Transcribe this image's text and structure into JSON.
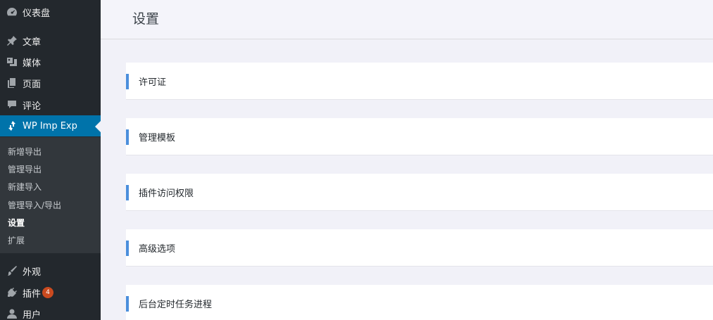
{
  "sidebar": {
    "items": [
      {
        "label": "仪表盘",
        "icon": "dashboard-icon"
      },
      {
        "label": "文章",
        "icon": "pin-icon"
      },
      {
        "label": "媒体",
        "icon": "media-icon"
      },
      {
        "label": "页面",
        "icon": "pages-icon"
      },
      {
        "label": "评论",
        "icon": "comment-icon"
      },
      {
        "label": "WP Imp Exp",
        "icon": "import-export-icon"
      },
      {
        "label": "外观",
        "icon": "brush-icon"
      },
      {
        "label": "插件",
        "icon": "plugin-icon",
        "badge": "4"
      },
      {
        "label": "用户",
        "icon": "user-icon"
      }
    ],
    "submenu": [
      {
        "label": "新增导出"
      },
      {
        "label": "管理导出"
      },
      {
        "label": "新建导入"
      },
      {
        "label": "管理导入/导出"
      },
      {
        "label": "设置",
        "active": true
      },
      {
        "label": "扩展"
      }
    ]
  },
  "header": {
    "title": "设置"
  },
  "panels": [
    {
      "title": "许可证"
    },
    {
      "title": "管理模板"
    },
    {
      "title": "插件访问权限"
    },
    {
      "title": "高级选项"
    },
    {
      "title": "后台定时任务进程"
    }
  ],
  "colors": {
    "sidebar_bg": "#23282d",
    "submenu_bg": "#32373c",
    "current_bg": "#0073aa",
    "accent_bar": "#4b8fdc",
    "badge_bg": "#ca4a1f"
  }
}
